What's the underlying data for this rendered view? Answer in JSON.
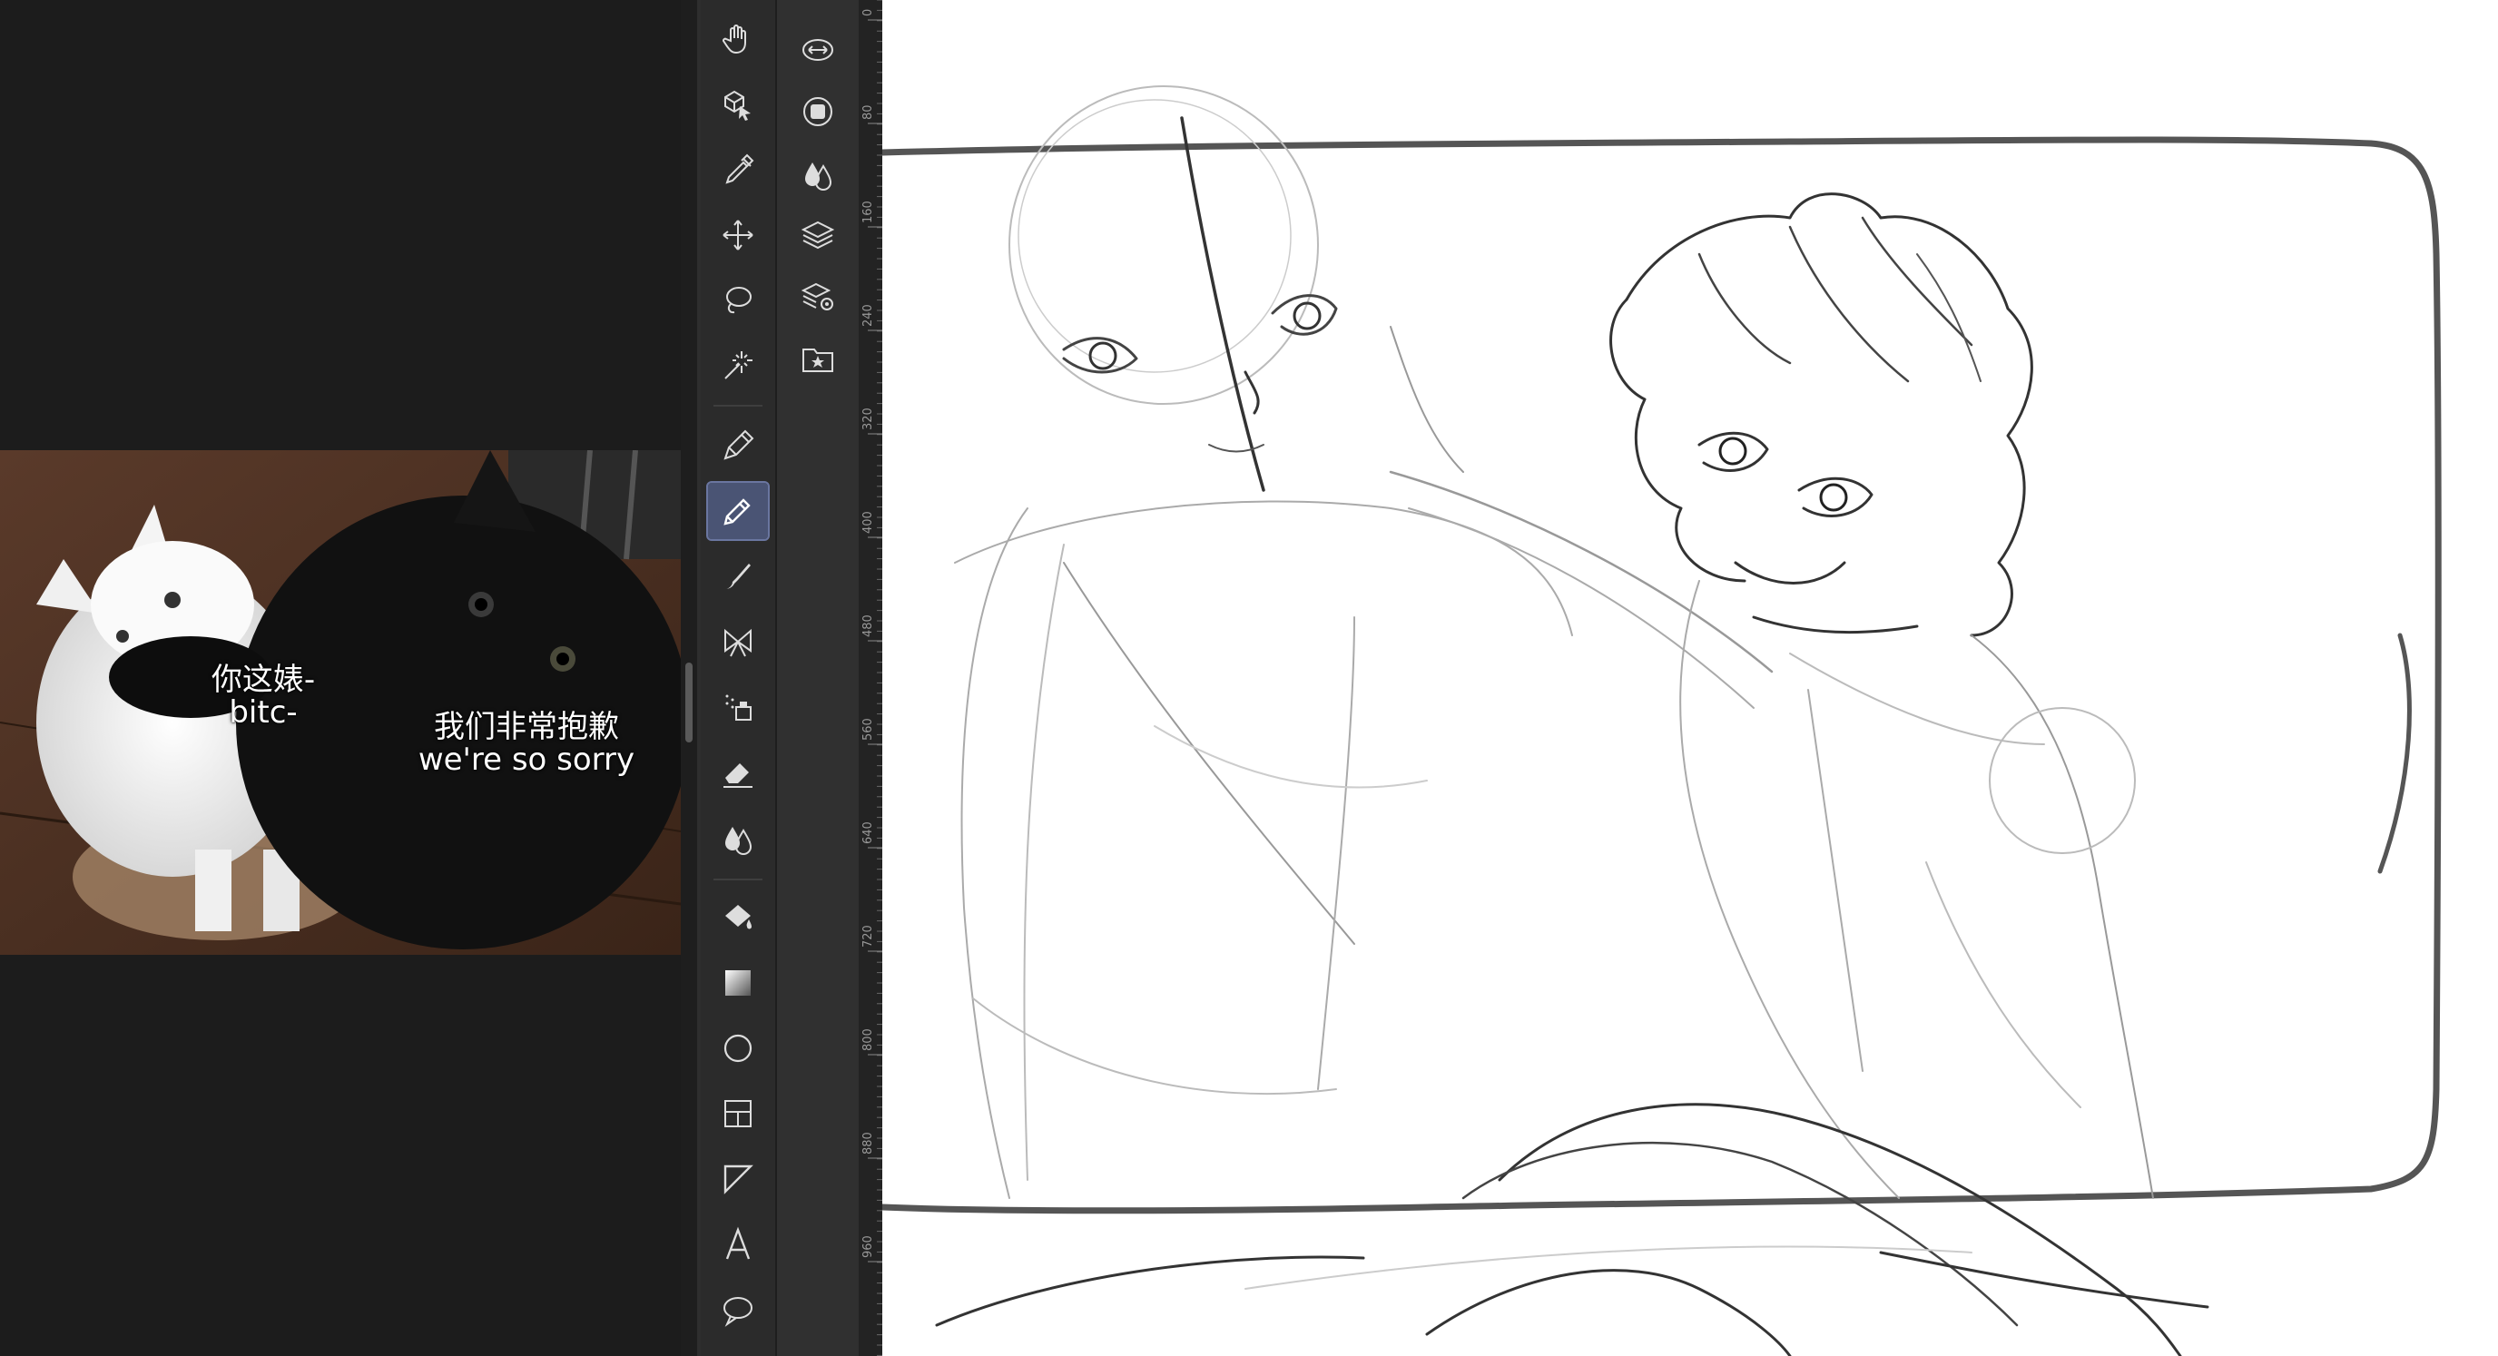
{
  "reference_panel": {
    "subtitle_left_cn": "你这婊-",
    "subtitle_left_en": "bitc-",
    "subtitle_right_cn": "我们非常抱歉",
    "subtitle_right_en": "we're so sorry"
  },
  "toolbar": {
    "tools": [
      {
        "name": "hand-icon"
      },
      {
        "name": "object-select-icon"
      },
      {
        "name": "eyedropper-icon"
      },
      {
        "name": "move-icon"
      },
      {
        "name": "lasso-icon"
      },
      {
        "name": "magic-wand-icon"
      },
      {
        "name": "pen-icon"
      },
      {
        "name": "pencil-icon",
        "active": true
      },
      {
        "name": "brush-icon"
      },
      {
        "name": "decoration-icon"
      },
      {
        "name": "airbrush-icon"
      },
      {
        "name": "eraser-icon"
      },
      {
        "name": "blend-icon"
      },
      {
        "name": "fill-icon"
      },
      {
        "name": "gradient-icon"
      },
      {
        "name": "ellipse-icon"
      },
      {
        "name": "frame-border-icon"
      },
      {
        "name": "ruler-icon"
      },
      {
        "name": "text-icon"
      },
      {
        "name": "balloon-icon"
      }
    ]
  },
  "sub_toolbar": {
    "items": [
      {
        "name": "transform-icon"
      },
      {
        "name": "layer-mask-icon"
      },
      {
        "name": "color-blend-icon"
      },
      {
        "name": "layers-icon"
      },
      {
        "name": "layer-settings-icon"
      },
      {
        "name": "material-folder-icon"
      }
    ]
  },
  "ruler": {
    "ticks": [
      "0",
      "80",
      "160",
      "240",
      "320",
      "400",
      "480",
      "560",
      "640",
      "720",
      "800",
      "880",
      "960"
    ]
  },
  "colors": {
    "active_tool_bg": "#4a5474",
    "panel_bg": "#2b2b2b",
    "canvas_bg": "#ffffff"
  }
}
